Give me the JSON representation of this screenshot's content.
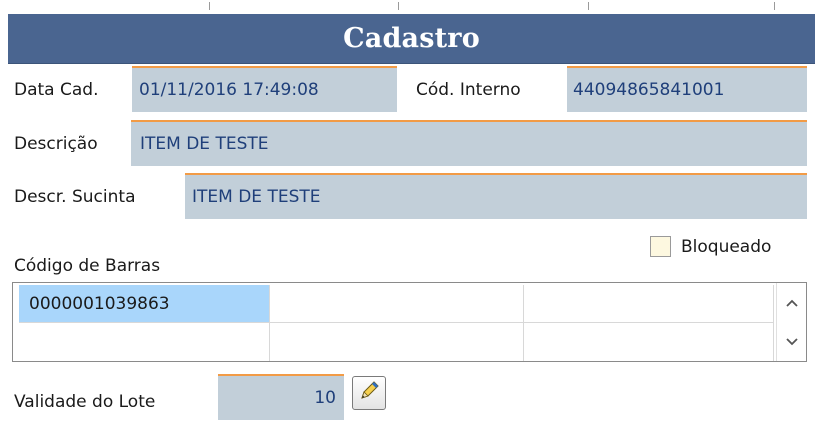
{
  "header": {
    "title": "Cadastro"
  },
  "form": {
    "data_cad": {
      "label": "Data Cad.",
      "value": "01/11/2016 17:49:08"
    },
    "cod_interno": {
      "label": "Cód. Interno",
      "value": "44094865841001"
    },
    "descricao": {
      "label": "Descrição",
      "value": "ITEM DE TESTE"
    },
    "descr_sucinta": {
      "label": "Descr. Sucinta",
      "value": "ITEM DE TESTE"
    },
    "bloqueado": {
      "label": "Bloqueado",
      "checked": false
    },
    "codigo_barras": {
      "label": "Código de Barras",
      "rows": [
        [
          "0000001039863",
          "",
          ""
        ],
        [
          "",
          "",
          ""
        ]
      ]
    },
    "validade_lote": {
      "label": "Validade do Lote",
      "value": "10"
    }
  },
  "icons": {
    "scroll_up": "chevron-up-icon",
    "scroll_down": "chevron-down-icon",
    "edit_button": "pencil-icon"
  },
  "colors": {
    "header_bg": "#4a6590",
    "field_bg": "#c2cfd9",
    "field_accent": "#f29b46",
    "selected_cell": "#a9d6fb"
  }
}
